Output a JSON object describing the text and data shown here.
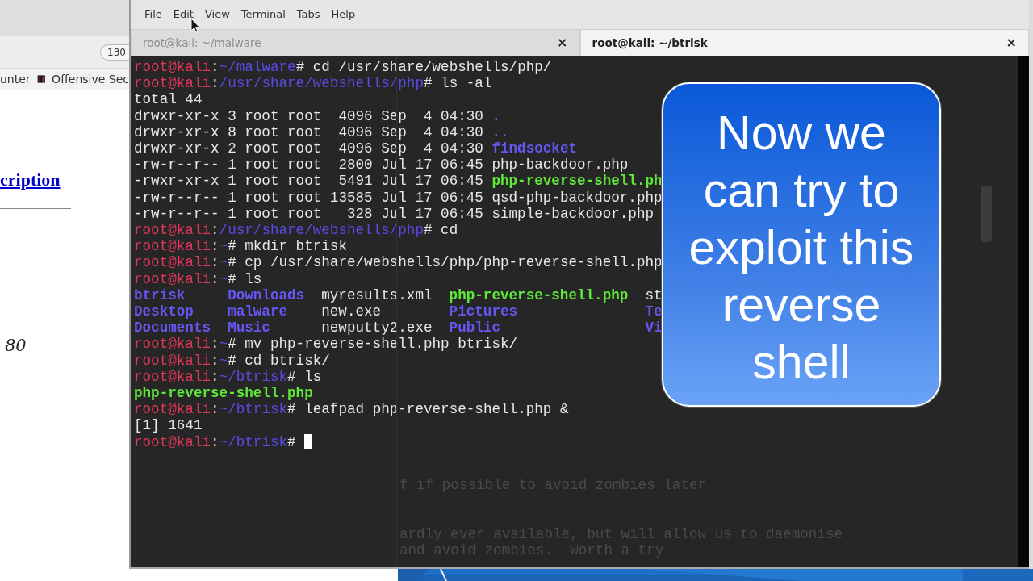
{
  "browser": {
    "zoom": "130",
    "bookmarks": [
      {
        "label": "unter",
        "icon": false
      },
      {
        "label": "Offensive Sec",
        "icon": true
      }
    ],
    "heading_link": "cription",
    "port": "80"
  },
  "terminal": {
    "menu": [
      "File",
      "Edit",
      "View",
      "Terminal",
      "Tabs",
      "Help"
    ],
    "tabs": [
      {
        "label": "root@kali: ~/malware",
        "close": "×",
        "selected": false
      },
      {
        "label": "root@kali: ~/btrisk",
        "close": "×",
        "selected": true
      }
    ],
    "lines": [
      {
        "kind": "text",
        "segments": [
          {
            "kind": "user",
            "text": "root@kali"
          },
          {
            "kind": "plain",
            "text": ":"
          },
          {
            "kind": "path",
            "text": "~/malware"
          },
          {
            "kind": "plain",
            "text": "# cd /usr/share/webshells/php/"
          }
        ]
      },
      {
        "kind": "text",
        "segments": [
          {
            "kind": "user",
            "text": "root@kali"
          },
          {
            "kind": "plain",
            "text": ":"
          },
          {
            "kind": "path",
            "text": "/usr/share/webshells/php"
          },
          {
            "kind": "plain",
            "text": "# ls -al"
          }
        ]
      },
      {
        "kind": "text",
        "segments": [
          {
            "kind": "plain",
            "text": "total 44"
          }
        ]
      },
      {
        "kind": "text",
        "segments": [
          {
            "kind": "plain",
            "text": "drwxr-xr-x 3 root root  4096 Sep  4 04:30 "
          },
          {
            "kind": "dir",
            "text": "."
          }
        ]
      },
      {
        "kind": "text",
        "segments": [
          {
            "kind": "plain",
            "text": "drwxr-xr-x 8 root root  4096 Sep  4 04:30 "
          },
          {
            "kind": "dir",
            "text": ".."
          }
        ]
      },
      {
        "kind": "text",
        "segments": [
          {
            "kind": "plain",
            "text": "drwxr-xr-x 2 root root  4096 Sep  4 04:30 "
          },
          {
            "kind": "dir",
            "text": "findsocket"
          }
        ]
      },
      {
        "kind": "text",
        "segments": [
          {
            "kind": "plain",
            "text": "-rw-r--r-- 1 root root  2800 Jul 17 06:45 php-backdoor.php"
          }
        ]
      },
      {
        "kind": "text",
        "segments": [
          {
            "kind": "plain",
            "text": "-rwxr-xr-x 1 root root  5491 Jul 17 06:45 "
          },
          {
            "kind": "exe",
            "text": "php-reverse-shell.ph"
          }
        ]
      },
      {
        "kind": "text",
        "segments": [
          {
            "kind": "plain",
            "text": "-rw-r--r-- 1 root root 13585 Jul 17 06:45 qsd-php-backdoor.php"
          }
        ]
      },
      {
        "kind": "text",
        "segments": [
          {
            "kind": "plain",
            "text": "-rw-r--r-- 1 root root   328 Jul 17 06:45 simple-backdoor.php"
          }
        ]
      },
      {
        "kind": "text",
        "segments": [
          {
            "kind": "user",
            "text": "root@kali"
          },
          {
            "kind": "plain",
            "text": ":"
          },
          {
            "kind": "path",
            "text": "/usr/share/webshells/php"
          },
          {
            "kind": "plain",
            "text": "# cd"
          }
        ]
      },
      {
        "kind": "text",
        "segments": [
          {
            "kind": "user",
            "text": "root@kali"
          },
          {
            "kind": "plain",
            "text": ":"
          },
          {
            "kind": "path",
            "text": "~"
          },
          {
            "kind": "plain",
            "text": "# mkdir btrisk"
          }
        ]
      },
      {
        "kind": "text",
        "segments": [
          {
            "kind": "user",
            "text": "root@kali"
          },
          {
            "kind": "plain",
            "text": ":"
          },
          {
            "kind": "path",
            "text": "~"
          },
          {
            "kind": "plain",
            "text": "# cp /usr/share/webshells/php/php-reverse-shell.php"
          }
        ]
      },
      {
        "kind": "text",
        "segments": [
          {
            "kind": "user",
            "text": "root@kali"
          },
          {
            "kind": "plain",
            "text": ":"
          },
          {
            "kind": "path",
            "text": "~"
          },
          {
            "kind": "plain",
            "text": "# ls"
          }
        ]
      },
      {
        "kind": "listing",
        "cells": [
          {
            "kind": "dir",
            "text": "btrisk"
          },
          {
            "kind": "dir",
            "text": "Downloads"
          },
          {
            "kind": "plain",
            "text": "myresults.xml"
          },
          {
            "kind": "exe",
            "text": "php-reverse-shell.php"
          },
          {
            "kind": "plain",
            "text": "st"
          }
        ]
      },
      {
        "kind": "listing",
        "cells": [
          {
            "kind": "dir",
            "text": "Desktop"
          },
          {
            "kind": "dir",
            "text": "malware"
          },
          {
            "kind": "plain",
            "text": "new.exe"
          },
          {
            "kind": "dir",
            "text": "Pictures"
          },
          {
            "kind": "dir",
            "text": "Te"
          }
        ]
      },
      {
        "kind": "listing",
        "cells": [
          {
            "kind": "dir",
            "text": "Documents"
          },
          {
            "kind": "dir",
            "text": "Music"
          },
          {
            "kind": "plain",
            "text": "newputty2.exe"
          },
          {
            "kind": "dir",
            "text": "Public"
          },
          {
            "kind": "dir",
            "text": "Vi"
          }
        ]
      },
      {
        "kind": "text",
        "segments": [
          {
            "kind": "user",
            "text": "root@kali"
          },
          {
            "kind": "plain",
            "text": ":"
          },
          {
            "kind": "path",
            "text": "~"
          },
          {
            "kind": "plain",
            "text": "# mv php-reverse-shell.php btrisk/"
          }
        ]
      },
      {
        "kind": "text",
        "segments": [
          {
            "kind": "user",
            "text": "root@kali"
          },
          {
            "kind": "plain",
            "text": ":"
          },
          {
            "kind": "path",
            "text": "~"
          },
          {
            "kind": "plain",
            "text": "# cd btrisk/"
          }
        ]
      },
      {
        "kind": "text",
        "segments": [
          {
            "kind": "user",
            "text": "root@kali"
          },
          {
            "kind": "plain",
            "text": ":"
          },
          {
            "kind": "path",
            "text": "~/btrisk"
          },
          {
            "kind": "plain",
            "text": "# ls"
          }
        ]
      },
      {
        "kind": "text",
        "segments": [
          {
            "kind": "exe",
            "text": "php-reverse-shell.php"
          }
        ]
      },
      {
        "kind": "text",
        "segments": [
          {
            "kind": "user",
            "text": "root@kali"
          },
          {
            "kind": "plain",
            "text": ":"
          },
          {
            "kind": "path",
            "text": "~/btrisk"
          },
          {
            "kind": "plain",
            "text": "# leafpad php-reverse-shell.php &"
          }
        ]
      },
      {
        "kind": "text",
        "segments": [
          {
            "kind": "plain",
            "text": "[1] 1641"
          }
        ]
      },
      {
        "kind": "text",
        "cursor": true,
        "segments": [
          {
            "kind": "user",
            "text": "root@kali"
          },
          {
            "kind": "plain",
            "text": ":"
          },
          {
            "kind": "path",
            "text": "~/btrisk"
          },
          {
            "kind": "plain",
            "text": "# "
          }
        ]
      }
    ],
    "background_text": [
      "f if possible to avoid zombies later",
      "ardly ever available, but will allow us to daemonise",
      "and avoid zombies.  Worth a try"
    ]
  },
  "callout": {
    "lines": [
      "Now we",
      "can try to",
      "exploit this",
      "reverse",
      "shell"
    ]
  }
}
